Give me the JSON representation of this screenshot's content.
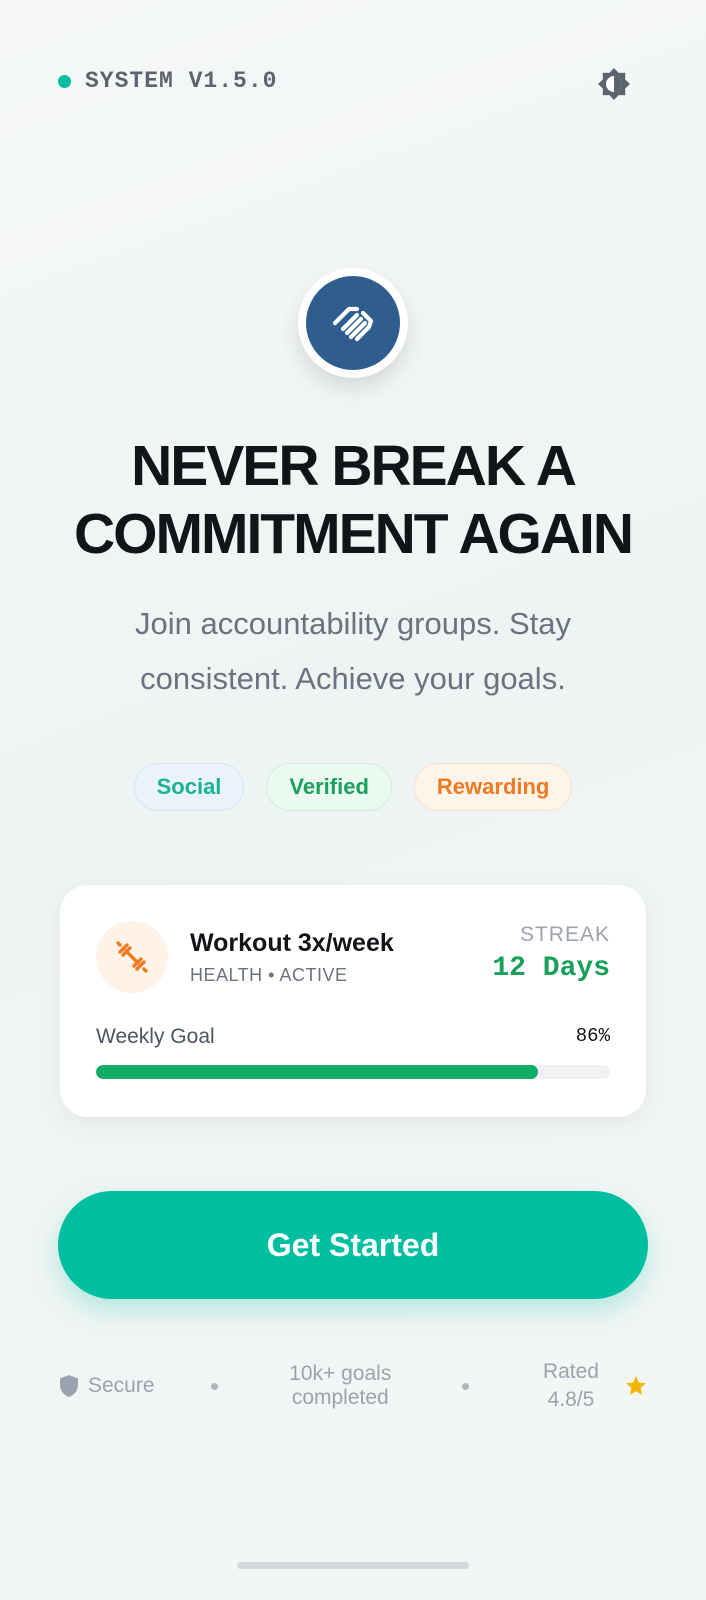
{
  "header": {
    "status_text": "SYSTEM V1.5.0",
    "status_color": "#00bfa0",
    "theme_icon": "brightness-icon"
  },
  "logo": {
    "icon": "handshake-icon",
    "color": "#2f5e8e"
  },
  "hero": {
    "headline_line1": "NEVER BREAK A",
    "headline_line2": "COMMITMENT AGAIN",
    "subtitle_line1": "Join accountability groups. Stay",
    "subtitle_line2": "consistent. Achieve your goals."
  },
  "chips": [
    {
      "label": "Social",
      "color": "#1ab394"
    },
    {
      "label": "Verified",
      "color": "#19a05b"
    },
    {
      "label": "Rewarding",
      "color": "#f07a22"
    }
  ],
  "goal_card": {
    "icon": "dumbbell-icon",
    "title": "Workout 3x/week",
    "subtitle": "HEALTH • ACTIVE",
    "streak_label": "STREAK",
    "streak_value": "12 Days",
    "goal_label": "Weekly Goal",
    "progress_text": "86%",
    "progress": 0.86
  },
  "cta": {
    "label": "Get Started",
    "color": "#00bfa0"
  },
  "footer": {
    "secure": "Secure",
    "stats_line1": "10k+ goals",
    "stats_line2": "completed",
    "rating_line1": "Rated",
    "rating_line2": "4.8/5"
  }
}
